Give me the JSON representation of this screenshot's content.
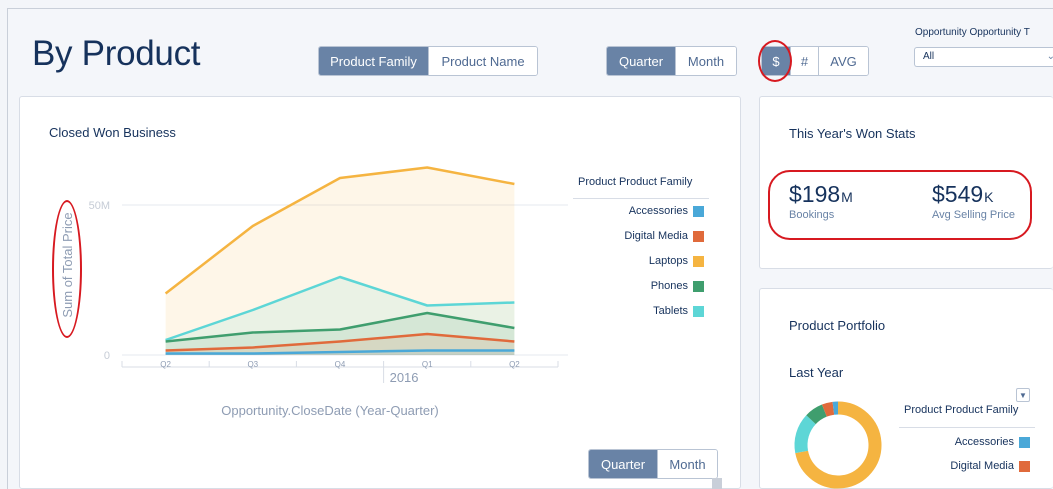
{
  "page": {
    "title": "By Product"
  },
  "group_toggle": {
    "options": [
      "Product Family",
      "Product Name"
    ],
    "selected": 0
  },
  "period_toggle": {
    "options": [
      "Quarter",
      "Month"
    ],
    "selected": 0
  },
  "measure_toggle": {
    "options": [
      "$",
      "#",
      "AVG"
    ],
    "selected": 0
  },
  "filter": {
    "label": "Opportunity Opportunity T",
    "value": "All"
  },
  "closed_won": {
    "title": "Closed Won Business",
    "period_toggle": {
      "options": [
        "Quarter",
        "Month"
      ],
      "selected": 0
    }
  },
  "won_stats": {
    "title": "This Year's Won Stats",
    "bookings": {
      "value": "$198",
      "unit": "M",
      "label": "Bookings"
    },
    "avg_price": {
      "value": "$549",
      "unit": "K",
      "label": "Avg Selling Price"
    }
  },
  "portfolio": {
    "title": "Product Portfolio",
    "subtitle": "Last Year",
    "legend_title": "Product Product Family",
    "legend": [
      {
        "name": "Accessories",
        "color": "#4aa8d8"
      },
      {
        "name": "Digital Media",
        "color": "#e06a3b"
      }
    ],
    "donut": [
      {
        "name": "Laptops",
        "value": 72,
        "color": "#f5b441"
      },
      {
        "name": "Tablets",
        "value": 15,
        "color": "#5dd6d6"
      },
      {
        "name": "Phones",
        "value": 7,
        "color": "#3f9e6e"
      },
      {
        "name": "Digital Media",
        "value": 4,
        "color": "#e06a3b"
      },
      {
        "name": "Accessories",
        "value": 2,
        "color": "#4aa8d8"
      }
    ]
  },
  "chart_data": {
    "type": "area",
    "title": "Closed Won Business",
    "xlabel": "Opportunity.CloseDate (Year-Quarter)",
    "ylabel": "Sum of Total Price",
    "year_label": "2016",
    "categories": [
      "Q2",
      "Q3",
      "Q4",
      "Q1",
      "Q2"
    ],
    "yticks": [
      {
        "value": 0,
        "label": "0"
      },
      {
        "value": 50,
        "label": "50M"
      }
    ],
    "ylim": [
      0,
      65
    ],
    "legend_title": "Product Product Family",
    "legend_position": "right",
    "series": [
      {
        "name": "Laptops",
        "color": "#f5b441",
        "values": [
          20.5,
          43,
          59,
          62.5,
          57
        ]
      },
      {
        "name": "Tablets",
        "color": "#5dd6d6",
        "values": [
          5,
          15,
          26,
          16.5,
          17.5
        ]
      },
      {
        "name": "Phones",
        "color": "#3f9e6e",
        "values": [
          4.5,
          7.5,
          8.5,
          14,
          9
        ]
      },
      {
        "name": "Digital Media",
        "color": "#e06a3b",
        "values": [
          1.5,
          2.5,
          4.5,
          7,
          4.5
        ]
      },
      {
        "name": "Accessories",
        "color": "#4aa8d8",
        "values": [
          0.5,
          0.5,
          1,
          1.5,
          1.5
        ]
      }
    ],
    "legend": [
      {
        "name": "Accessories",
        "color": "#4aa8d8"
      },
      {
        "name": "Digital Media",
        "color": "#e06a3b"
      },
      {
        "name": "Laptops",
        "color": "#f5b441"
      },
      {
        "name": "Phones",
        "color": "#3f9e6e"
      },
      {
        "name": "Tablets",
        "color": "#5dd6d6"
      }
    ]
  }
}
